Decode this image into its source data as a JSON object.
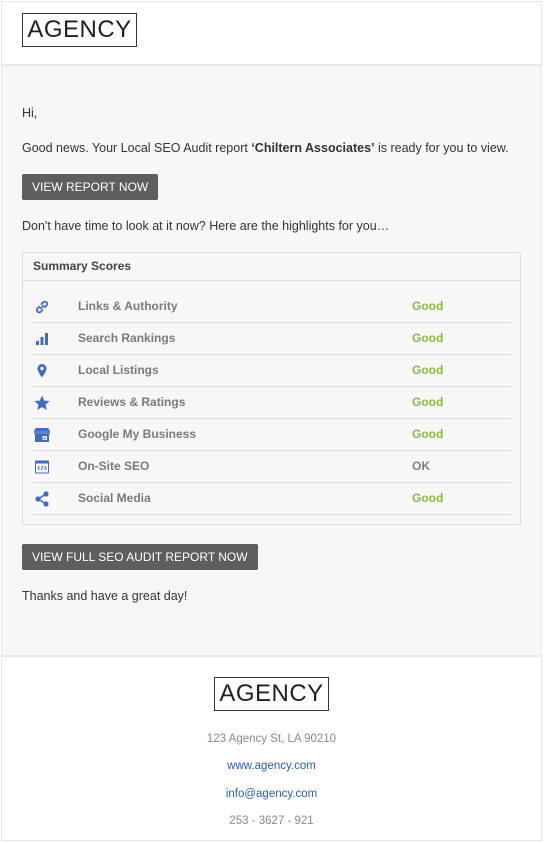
{
  "header": {
    "logo_text": "AGENCY"
  },
  "body": {
    "greeting": "Hi,",
    "news_prefix": "Good news. Your Local SEO Audit report ",
    "report_name": "‘Chiltern Associates’",
    "news_suffix": " is ready for you to view.",
    "view_report_button": "VIEW REPORT NOW",
    "highlights_text": "Don't have time to look at it now? Here are the highlights for you…",
    "summary": {
      "title": "Summary Scores",
      "rows": [
        {
          "label": "Links & Authority",
          "score": "Good",
          "icon": "link-icon"
        },
        {
          "label": "Search Rankings",
          "score": "Good",
          "icon": "bar-chart-icon"
        },
        {
          "label": "Local Listings",
          "score": "Good",
          "icon": "map-pin-icon"
        },
        {
          "label": "Reviews & Ratings",
          "score": "Good",
          "icon": "star-icon"
        },
        {
          "label": "Google My Business",
          "score": "Good",
          "icon": "store-icon"
        },
        {
          "label": "On-Site SEO",
          "score": "OK",
          "icon": "code-window-icon"
        },
        {
          "label": "Social Media",
          "score": "Good",
          "icon": "share-icon"
        }
      ]
    },
    "full_report_button": "VIEW FULL SEO AUDIT REPORT NOW",
    "closing": "Thanks and have a great day!"
  },
  "footer": {
    "logo_text": "AGENCY",
    "address": "123 Agency St, LA 90210",
    "website": "www.agency.com",
    "email": "info@agency.com",
    "phone": "253 - 3627 - 921"
  },
  "colors": {
    "good": "#8cb83f",
    "ok": "#7f7f7f",
    "icon_blue": "#3f6cc0",
    "button_bg": "#5e5e5e",
    "link": "#2a5bbf"
  }
}
